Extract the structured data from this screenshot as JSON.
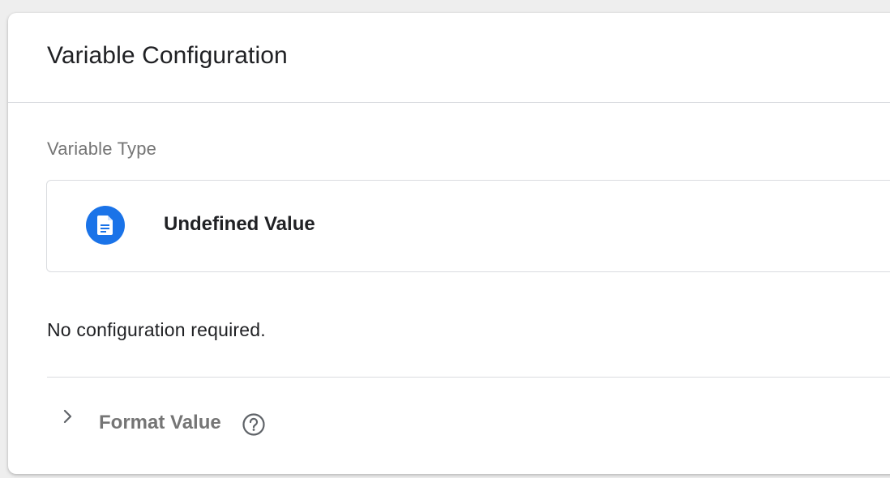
{
  "panel": {
    "title": "Variable Configuration"
  },
  "variable_type": {
    "section_label": "Variable Type",
    "name": "Undefined Value",
    "icon": "document-icon",
    "icon_color": "#1a73e8"
  },
  "configuration": {
    "note": "No configuration required."
  },
  "format_value": {
    "label": "Format Value",
    "expand_icon": "chevron-right-icon",
    "help_icon": "help-circle-icon",
    "expanded": false
  }
}
